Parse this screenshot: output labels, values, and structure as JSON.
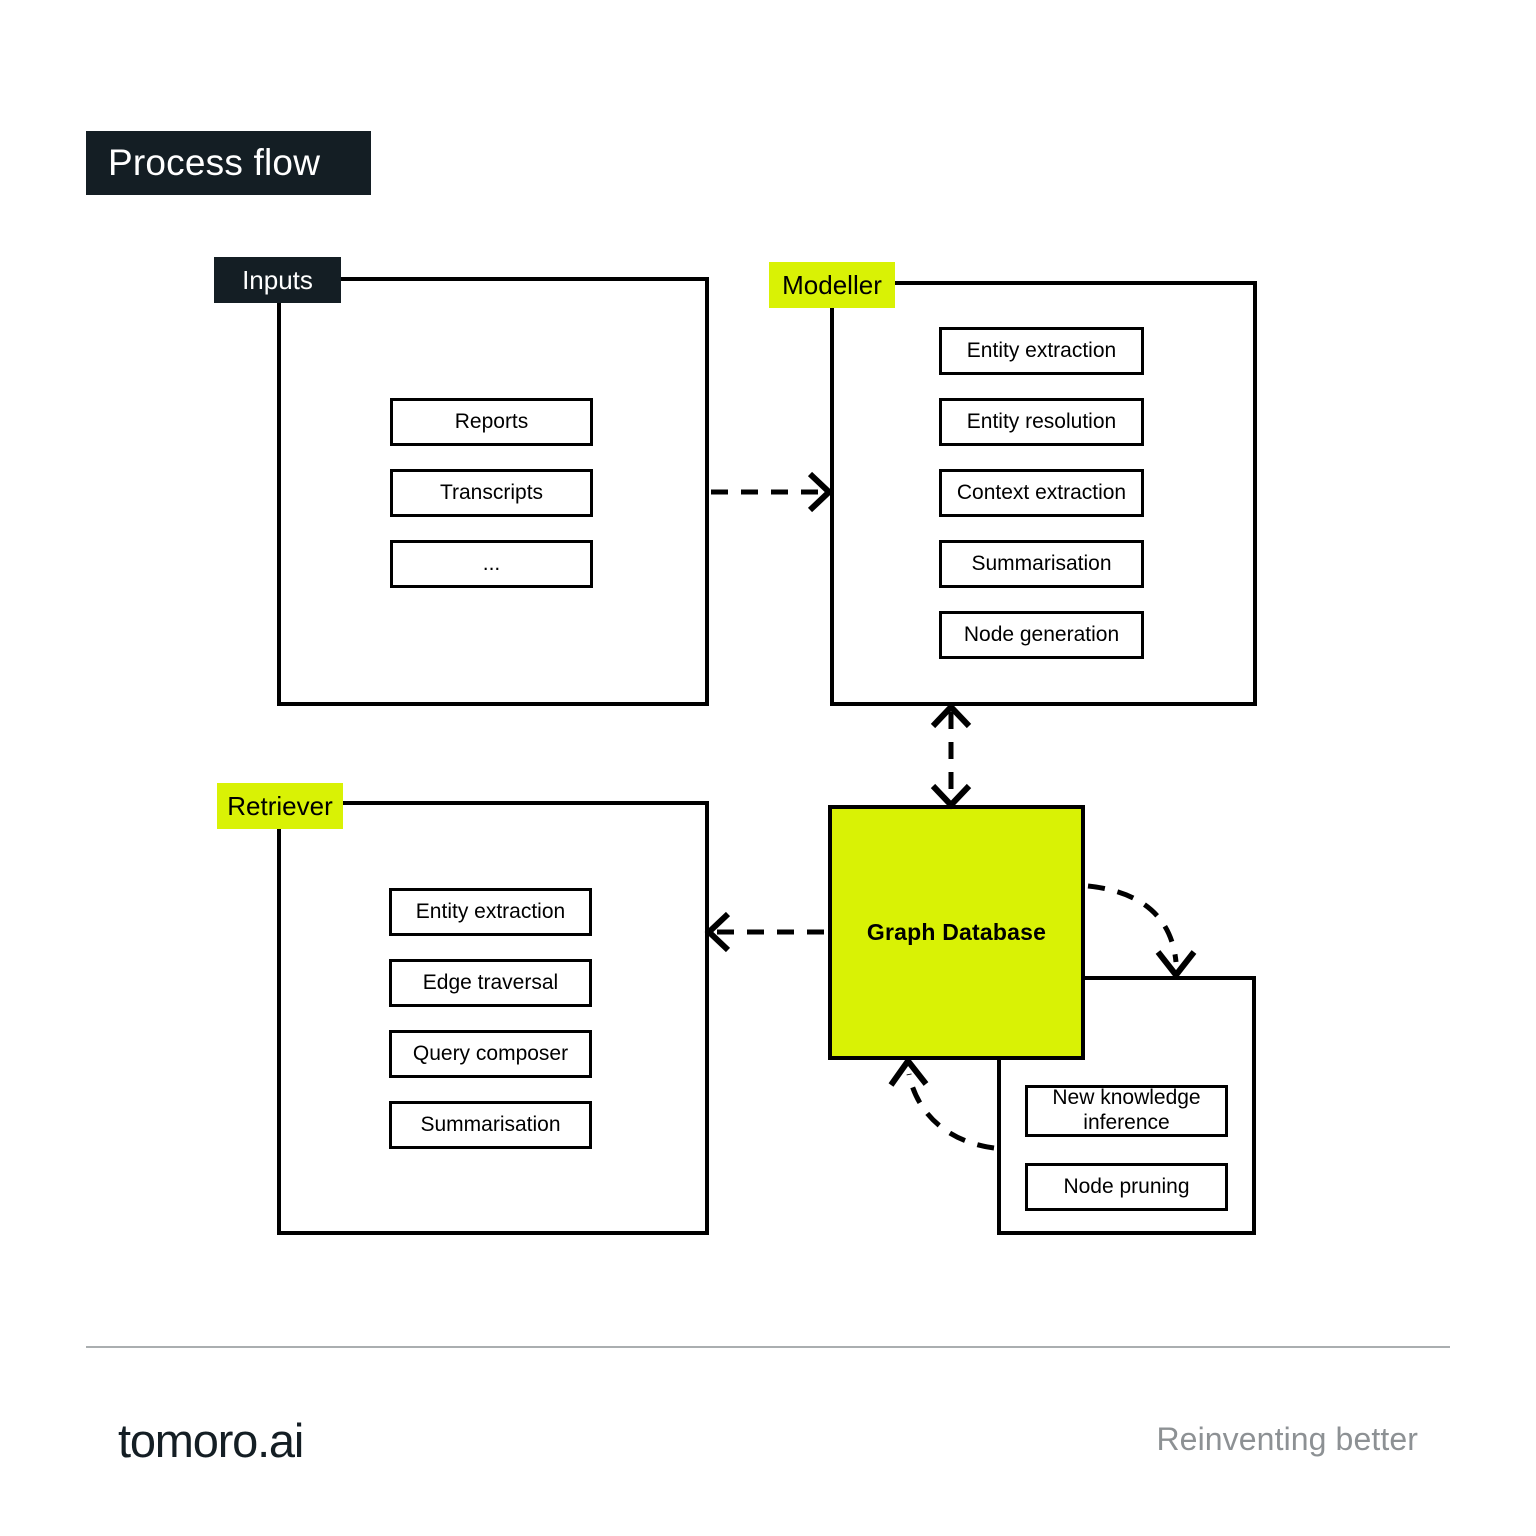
{
  "page": {
    "title": "Process flow",
    "background": "#ffffff",
    "accent_lime": "#d9f205",
    "accent_dark": "#141e24"
  },
  "groups": {
    "inputs": {
      "label": "Inputs",
      "label_style": "dark",
      "items": [
        {
          "label": "Reports"
        },
        {
          "label": "Transcripts"
        },
        {
          "label": "..."
        }
      ]
    },
    "modeller": {
      "label": "Modeller",
      "label_style": "lime",
      "items": [
        {
          "label": "Entity extraction"
        },
        {
          "label": "Entity resolution"
        },
        {
          "label": "Context extraction"
        },
        {
          "label": "Summarisation"
        },
        {
          "label": "Node generation"
        }
      ]
    },
    "retriever": {
      "label": "Retriever",
      "label_style": "lime",
      "items": [
        {
          "label": "Entity extraction"
        },
        {
          "label": "Edge traversal"
        },
        {
          "label": "Query composer"
        },
        {
          "label": "Summarisation"
        }
      ]
    },
    "maintenance": {
      "label": "",
      "items": [
        {
          "label": "New knowledge inference"
        },
        {
          "label": "Node pruning"
        }
      ]
    }
  },
  "graph_database": {
    "label": "Graph Database",
    "fill": "#d9f205"
  },
  "connectors": [
    {
      "name": "inputs-to-modeller",
      "style": "dashed",
      "direction": "right"
    },
    {
      "name": "modeller-to-graph-database",
      "style": "dashed",
      "direction": "both"
    },
    {
      "name": "graph-database-to-retriever",
      "style": "dashed",
      "direction": "left"
    },
    {
      "name": "graph-database-to-maintenance",
      "style": "dashed-curve",
      "direction": "down"
    },
    {
      "name": "maintenance-to-graph-database",
      "style": "dashed-curve",
      "direction": "up"
    }
  ],
  "footer": {
    "brand": "tomoro.ai",
    "tagline": "Reinventing better"
  }
}
